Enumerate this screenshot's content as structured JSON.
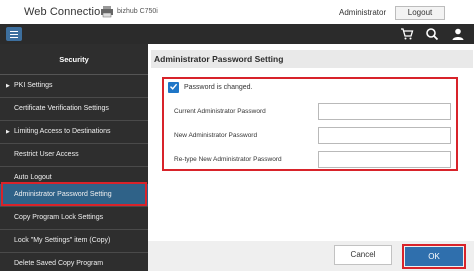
{
  "header": {
    "brand": "Web Connection",
    "model": "bizhub C750i",
    "user": "Administrator",
    "logout_label": "Logout"
  },
  "toolbar": {
    "icons": [
      "menu-icon",
      "cart-icon",
      "search-icon",
      "user-icon"
    ]
  },
  "sidebar": {
    "title": "Security",
    "items": [
      {
        "label": "PKI Settings",
        "arrow": true
      },
      {
        "label": "Certificate Verification Settings",
        "arrow": false
      },
      {
        "label": "Limiting Access to Destinations",
        "arrow": true
      },
      {
        "label": "Restrict User Access",
        "arrow": false
      },
      {
        "label": "Auto Logout",
        "arrow": false
      },
      {
        "label": "Administrator Password Setting",
        "arrow": false,
        "active": true
      },
      {
        "label": "Copy Program Lock Settings",
        "arrow": false
      },
      {
        "label": "Lock \"My Settings\" item (Copy)",
        "arrow": false
      },
      {
        "label": "Delete Saved Copy Program",
        "arrow": false
      }
    ]
  },
  "main": {
    "title": "Administrator Password Setting",
    "checkbox_label": "Password is changed.",
    "fields": [
      {
        "label": "Current Administrator Password",
        "value": ""
      },
      {
        "label": "New Administrator Password",
        "value": ""
      },
      {
        "label": "Re-type New Administrator Password",
        "value": ""
      }
    ],
    "cancel_label": "Cancel",
    "ok_label": "OK"
  },
  "colors": {
    "accent": "#2f6fad",
    "highlight": "#d8232a",
    "sidebar_bg": "#2e2e2e",
    "active_item": "#2f6288"
  }
}
